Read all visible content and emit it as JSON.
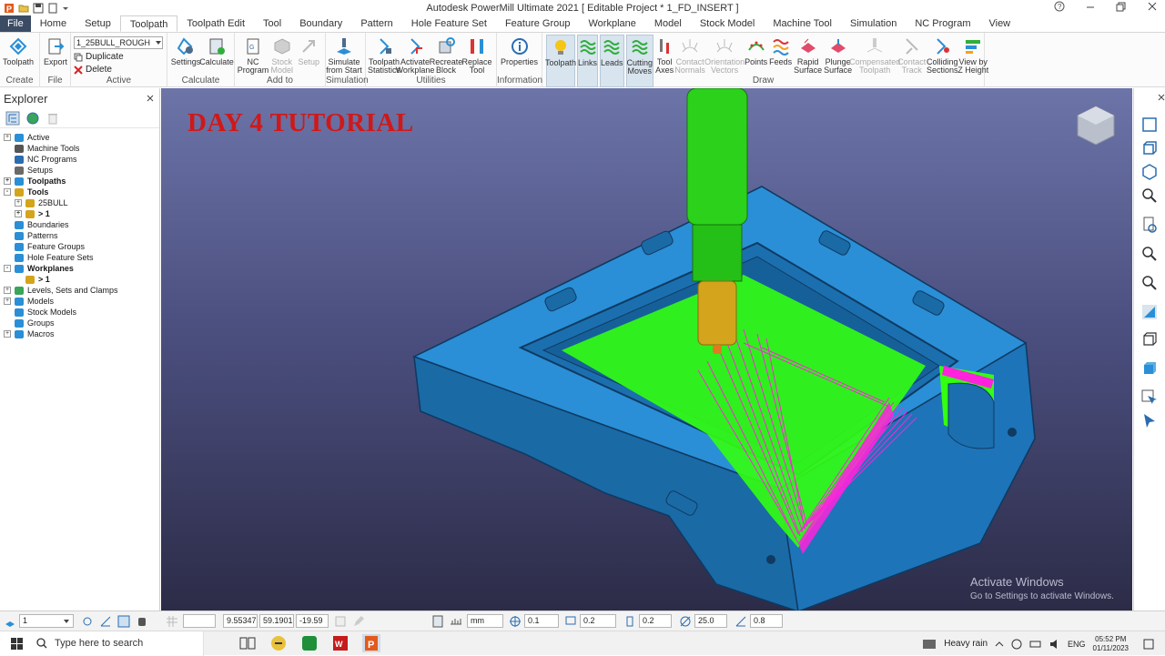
{
  "app": {
    "title": "Autodesk PowerMill Ultimate 2021    [ Editable Project * 1_FD_INSERT ]"
  },
  "tabs": [
    "File",
    "Home",
    "Setup",
    "Toolpath",
    "Toolpath Edit",
    "Tool",
    "Boundary",
    "Pattern",
    "Hole Feature Set",
    "Feature Group",
    "Workplane",
    "Model",
    "Stock Model",
    "Machine Tool",
    "Simulation",
    "NC Program",
    "View"
  ],
  "active_tab": "Toolpath",
  "ribbon": {
    "create": {
      "label": "Create",
      "toolpath": "Toolpath"
    },
    "file": {
      "label": "File",
      "export": "Export"
    },
    "active": {
      "label": "Active",
      "dropdown": "1_25BULL_ROUGH",
      "duplicate": "Duplicate",
      "delete": "Delete"
    },
    "calculate": {
      "label": "Calculate",
      "settings": "Settings",
      "calculate": "Calculate"
    },
    "addto": {
      "label": "Add to",
      "nc_program": "NC\nProgram",
      "stock_model": "Stock\nModel",
      "setup": "Setup"
    },
    "simulation": {
      "label": "Simulation",
      "simulate": "Simulate\nfrom Start"
    },
    "utilities": {
      "label": "Utilities",
      "stats": "Toolpath\nStatistics",
      "activate": "Activate\nWorkplane",
      "recreate": "Recreate\nBlock",
      "replace": "Replace\nTool"
    },
    "information": {
      "label": "Information",
      "properties": "Properties"
    },
    "draw": {
      "label": "Draw",
      "items": [
        "Toolpath",
        "Links",
        "Leads",
        "Cutting\nMoves",
        "Tool\nAxes",
        "Contact\nNormals",
        "Orientation\nVectors",
        "Points",
        "Feeds",
        "Rapid\nSurface",
        "Plunge\nSurface",
        "Compensated\nToolpath",
        "Contact\nTrack",
        "Colliding\nSections",
        "View by\nZ Height"
      ]
    }
  },
  "explorer": {
    "title": "Explorer",
    "tree": [
      {
        "label": "Active",
        "level": 0,
        "bold": false,
        "exp": "+"
      },
      {
        "label": "Machine Tools",
        "level": 0,
        "bold": false,
        "exp": ""
      },
      {
        "label": "NC Programs",
        "level": 0,
        "bold": false,
        "exp": ""
      },
      {
        "label": "Setups",
        "level": 0,
        "bold": false,
        "exp": ""
      },
      {
        "label": "Toolpaths",
        "level": 0,
        "bold": true,
        "exp": "+"
      },
      {
        "label": "Tools",
        "level": 0,
        "bold": true,
        "exp": "-"
      },
      {
        "label": "25BULL",
        "level": 1,
        "bold": false,
        "exp": "+"
      },
      {
        "label": "> 1",
        "level": 1,
        "bold": true,
        "exp": "+"
      },
      {
        "label": "Boundaries",
        "level": 0,
        "bold": false,
        "exp": ""
      },
      {
        "label": "Patterns",
        "level": 0,
        "bold": false,
        "exp": ""
      },
      {
        "label": "Feature Groups",
        "level": 0,
        "bold": false,
        "exp": ""
      },
      {
        "label": "Hole Feature Sets",
        "level": 0,
        "bold": false,
        "exp": ""
      },
      {
        "label": "Workplanes",
        "level": 0,
        "bold": true,
        "exp": "-"
      },
      {
        "label": "> 1",
        "level": 1,
        "bold": true,
        "exp": ""
      },
      {
        "label": "Levels, Sets and Clamps",
        "level": 0,
        "bold": false,
        "exp": "+"
      },
      {
        "label": "Models",
        "level": 0,
        "bold": false,
        "exp": "+"
      },
      {
        "label": "Stock Models",
        "level": 0,
        "bold": false,
        "exp": ""
      },
      {
        "label": "Groups",
        "level": 0,
        "bold": false,
        "exp": ""
      },
      {
        "label": "Macros",
        "level": 0,
        "bold": false,
        "exp": "+"
      }
    ]
  },
  "viewport": {
    "overlay_title": "DAY 4 TUTORIAL",
    "watermark_line1": "Activate Windows",
    "watermark_line2": "Go to Settings to activate Windows."
  },
  "statusbar": {
    "level": "1",
    "x": "9.55347",
    "y": "59.1901",
    "z": "-19.59",
    "units": "mm",
    "tol1": "0.1",
    "tol2": "0.2",
    "tol3": "0.2",
    "angle": "25.0",
    "step": "0.8"
  },
  "taskbar": {
    "search_placeholder": "Type here to search",
    "weather": "Heavy rain",
    "lang": "ENG",
    "time": "05:52 PM",
    "date": "01/11/2023"
  },
  "colors": {
    "accent": "#2a6db0",
    "part_blue": "#1f7fc4",
    "toolpath_green": "#33ff11",
    "links_magenta": "#ff22dd",
    "tool_green": "#2bd11b",
    "holder_gold": "#d4a41c",
    "title_red": "#d01818"
  }
}
